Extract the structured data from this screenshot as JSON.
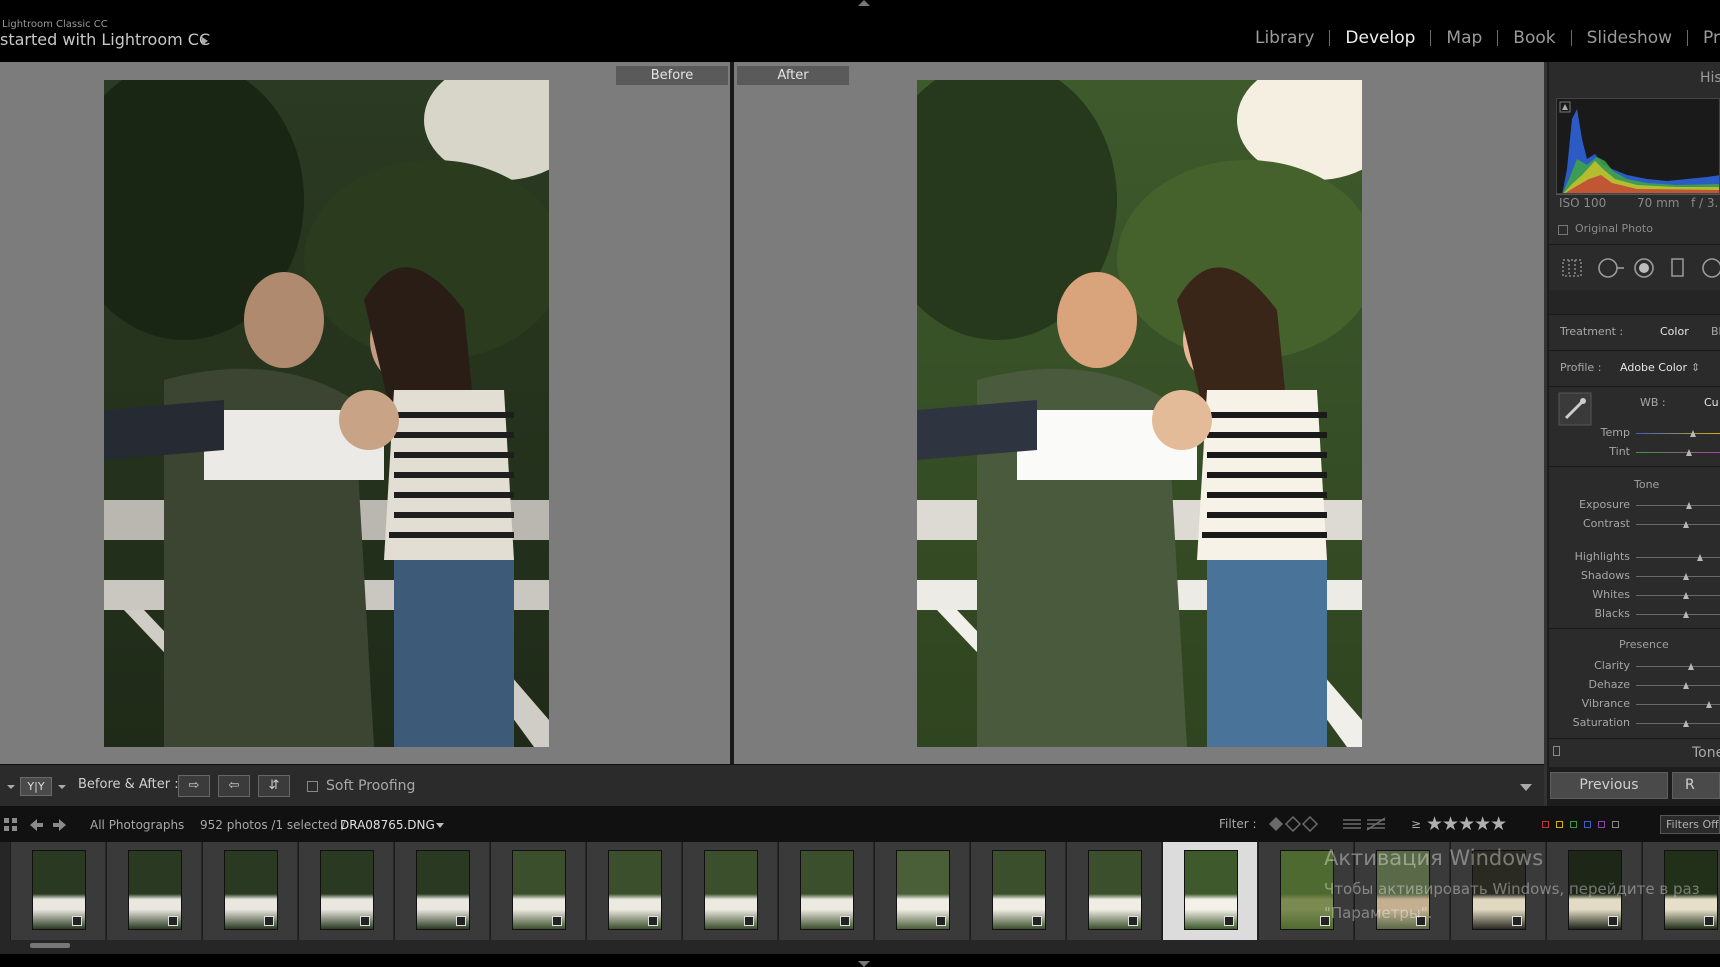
{
  "header": {
    "app_small": "Lightroom Classic CC",
    "app_title": "started with Lightroom CC",
    "modules": [
      "Library",
      "Develop",
      "Map",
      "Book",
      "Slideshow",
      "Pr"
    ],
    "active_module": "Develop"
  },
  "view": {
    "before_label": "Before",
    "after_label": "After"
  },
  "toolbar": {
    "view_mode": "Y|Y",
    "before_after_label": "Before & After :",
    "soft_proofing": "Soft Proofing",
    "btn_copy_before_to_after": "⇨",
    "btn_copy_after_to_before": "⇦",
    "btn_swap": "⇵"
  },
  "right_panel": {
    "panel_title": "His",
    "iso": "ISO 100",
    "focal": "70 mm",
    "aperture": "f / 3.",
    "original_photo": "Original Photo",
    "treatment_label": "Treatment :",
    "treatment_value": "Color",
    "treatment_alt": "Bl",
    "profile_label": "Profile :",
    "profile_value": "Adobe Color",
    "profile_caret": "⇕",
    "wb_label": "WB :",
    "wb_value": "Cu",
    "tone_heading": "Tone",
    "presence_heading": "Presence",
    "next_section": "Tone",
    "sliders": [
      {
        "label": "Temp",
        "value": 0.52
      },
      {
        "label": "Tint",
        "value": 0.48
      },
      {
        "label": "Exposure",
        "value": 0.48
      },
      {
        "label": "Contrast",
        "value": 0.45
      },
      {
        "label": "Highlights",
        "value": 0.58
      },
      {
        "label": "Shadows",
        "value": 0.45
      },
      {
        "label": "Whites",
        "value": 0.45
      },
      {
        "label": "Blacks",
        "value": 0.45
      },
      {
        "label": "Clarity",
        "value": 0.5
      },
      {
        "label": "Dehaze",
        "value": 0.45
      },
      {
        "label": "Vibrance",
        "value": 0.66
      },
      {
        "label": "Saturation",
        "value": 0.45
      }
    ],
    "previous_button": "Previous",
    "next_button": "R"
  },
  "filmstrip_bar": {
    "source": "All Photographs",
    "count": "952 photos /1 selected /",
    "filename": "DRA08765.DNG",
    "filter_label": "Filter :",
    "stars_prefix": "≥",
    "stars": "★★★★★",
    "filters_off": "Filters Off",
    "label_colors": [
      "#c0392b",
      "#d4b106",
      "#3c9a3c",
      "#3a5fcd",
      "#8e44ad",
      "#888888"
    ]
  },
  "filmstrip": {
    "selected_index": 12,
    "thumb_count": 18
  },
  "watermark": {
    "line1": "Активация Windows",
    "line2": "Чтобы активировать Windows, перейдите в раз",
    "line3": "\"Параметры\"."
  }
}
